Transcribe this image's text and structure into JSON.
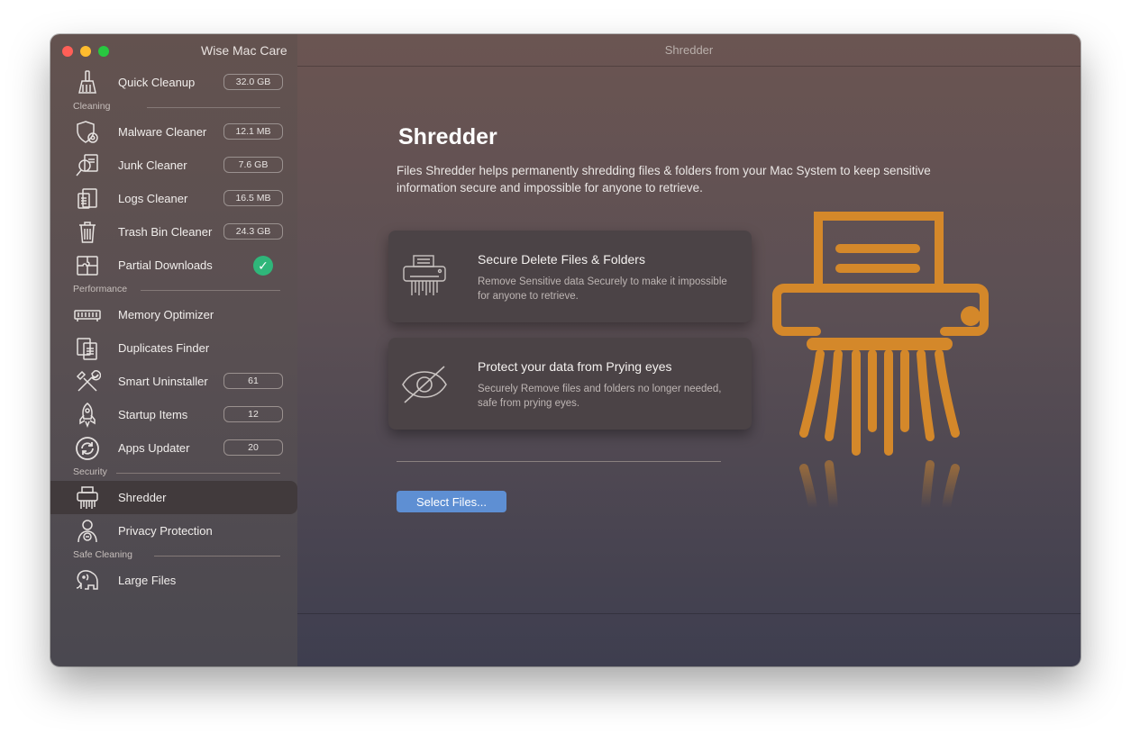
{
  "window": {
    "app_title": "Wise Mac Care",
    "title": "Shredder"
  },
  "sidebar": {
    "top_item": {
      "label": "Quick Cleanup",
      "badge": "32.0 GB",
      "icon": "broom-icon"
    },
    "sections": [
      {
        "label": "Cleaning",
        "items": [
          {
            "label": "Malware Cleaner",
            "badge": "12.1 MB",
            "icon": "shield-gear-icon"
          },
          {
            "label": "Junk Cleaner",
            "badge": "7.6 GB",
            "icon": "magnifier-doc-icon"
          },
          {
            "label": "Logs Cleaner",
            "badge": "16.5 MB",
            "icon": "log-doc-icon"
          },
          {
            "label": "Trash Bin Cleaner",
            "badge": "24.3 GB",
            "icon": "trash-icon"
          },
          {
            "label": "Partial Downloads",
            "icon": "puzzle-icon",
            "status": "check"
          }
        ]
      },
      {
        "label": "Performance",
        "items": [
          {
            "label": "Memory Optimizer",
            "icon": "memory-chip-icon"
          },
          {
            "label": "Duplicates Finder",
            "icon": "duplicate-docs-icon"
          },
          {
            "label": "Smart Uninstaller",
            "badge": "61",
            "icon": "wrench-screwdriver-icon"
          },
          {
            "label": "Startup Items",
            "badge": "12",
            "icon": "rocket-icon"
          },
          {
            "label": "Apps Updater",
            "badge": "20",
            "icon": "refresh-icon"
          }
        ]
      },
      {
        "label": "Security",
        "items": [
          {
            "label": "Shredder",
            "icon": "shredder-icon",
            "active": true
          },
          {
            "label": "Privacy Protection",
            "icon": "privacy-person-icon"
          }
        ]
      },
      {
        "label": "Safe Cleaning",
        "items": [
          {
            "label": "Large Files",
            "icon": "elephant-icon"
          }
        ]
      }
    ]
  },
  "main": {
    "heading": "Shredder",
    "description": "Files Shredder helps permanently shredding files & folders from your Mac System to keep sensitive information secure and impossible for anyone to retrieve.",
    "cards": [
      {
        "title": "Secure Delete Files & Folders",
        "description": "Remove Sensitive data Securely to make it impossible for anyone to retrieve.",
        "icon": "shredder-icon"
      },
      {
        "title": "Protect your data from Prying eyes",
        "description": "Securely Remove files and folders no longer needed, safe from prying eyes.",
        "icon": "eye-slash-icon"
      }
    ],
    "select_button": "Select Files...",
    "illustration": "shredder-illustration"
  },
  "colors": {
    "accent_orange": "#d4882a",
    "button_blue": "#5e8fd3",
    "check_green": "#2fb67a"
  }
}
